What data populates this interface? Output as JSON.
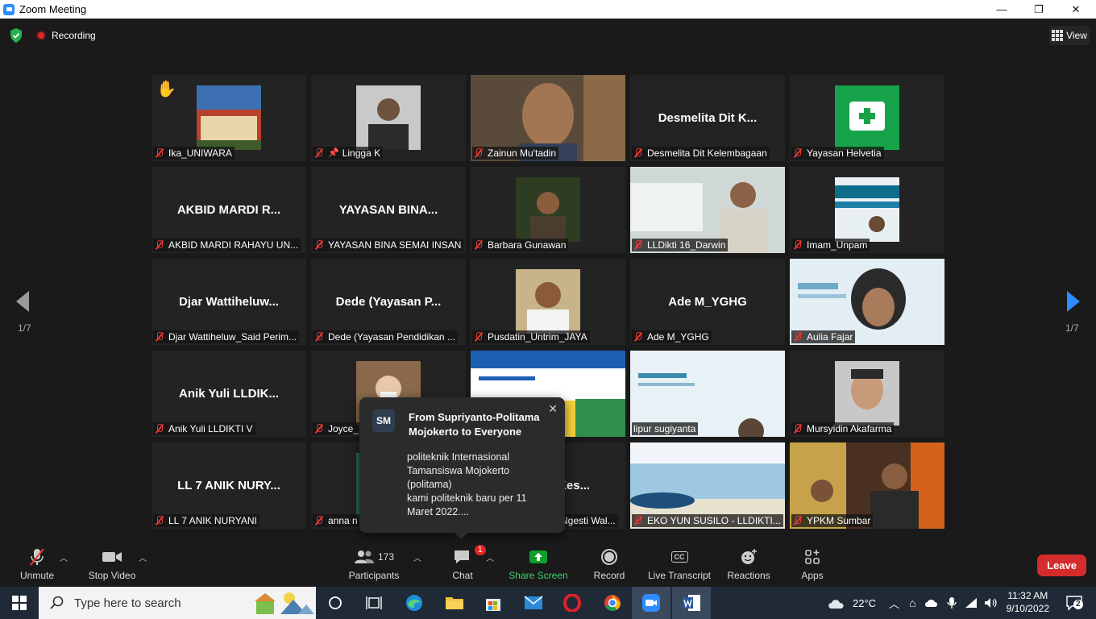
{
  "window": {
    "title": "Zoom Meeting",
    "minimize": "—",
    "maximize": "❐",
    "close": "✕"
  },
  "topbar": {
    "recording": "Recording",
    "view": "View"
  },
  "nav": {
    "page_left": "1/7",
    "page_right": "1/7"
  },
  "tiles": [
    {
      "caption": "Ika_UNIWARA",
      "kind": "photo",
      "hand": "✋"
    },
    {
      "caption": "Lingga K",
      "kind": "photo",
      "pinned": true
    },
    {
      "caption": "Zainun Mu'tadin",
      "kind": "video"
    },
    {
      "caption": "Desmelita  Dit Kelembagaan",
      "kind": "name",
      "bigname": "Desmelita  Dit K..."
    },
    {
      "caption": "Yayasan Helvetia",
      "kind": "logo"
    },
    {
      "caption": "AKBID MARDI RAHAYU UN...",
      "kind": "name",
      "bigname": "AKBID MARDI R..."
    },
    {
      "caption": "YAYASAN BINA SEMAI INSAN",
      "kind": "name",
      "bigname": "YAYASAN BINA..."
    },
    {
      "caption": "Barbara Gunawan",
      "kind": "photo"
    },
    {
      "caption": "LLDikti 16_Darwin",
      "kind": "video"
    },
    {
      "caption": "Imam_Unpam",
      "kind": "photo"
    },
    {
      "caption": "Djar Wattiheluw_Said Perim...",
      "kind": "name",
      "bigname": "Djar  Wattiheluw..."
    },
    {
      "caption": "Dede (Yayasan Pendidikan ...",
      "kind": "name",
      "bigname": "Dede (Yayasan P..."
    },
    {
      "caption": "Pusdatin_Untrim_JAYA",
      "kind": "photo"
    },
    {
      "caption": "Ade M_YGHG",
      "kind": "name",
      "bigname": "Ade M_YGHG"
    },
    {
      "caption": "Aulia Fajar",
      "kind": "video"
    },
    {
      "caption": "Anik Yuli LLDIKTI V",
      "kind": "name",
      "bigname": "Anik Yuli LLDIK..."
    },
    {
      "caption": "Joyce_",
      "kind": "photo"
    },
    {
      "caption": "",
      "kind": "video",
      "active": true
    },
    {
      "caption": "lipur sugiyanta",
      "kind": "video"
    },
    {
      "caption": "Mursyidin Akafarma",
      "kind": "photo"
    },
    {
      "caption": "LL 7 ANIK NURYANI",
      "kind": "name",
      "bigname": "LL 7 ANIK NURY..."
    },
    {
      "caption": "anna n",
      "kind": "photo"
    },
    {
      "caption": "Ngesti Wal...",
      "kind": "name",
      "bigname": "IKes..."
    },
    {
      "caption": "EKO YUN SUSILO - LLDIKTI...",
      "kind": "video"
    },
    {
      "caption": "YPKM Sumbar",
      "kind": "video"
    }
  ],
  "chat_popup": {
    "avatar": "SM",
    "from": "From Supriyanto-Politama Mojokerto to Everyone",
    "message": "politeknik Internasional Tamansiswa Mojokerto (politama)\nkami politeknik baru per 11 Maret 2022...."
  },
  "toolbar": {
    "unmute": "Unmute",
    "stop_video": "Stop Video",
    "participants": "Participants",
    "participants_count": "173",
    "chat": "Chat",
    "chat_badge": "1",
    "share_screen": "Share Screen",
    "record": "Record",
    "cc": "CC",
    "live_transcript": "Live Transcript",
    "reactions": "Reactions",
    "apps": "Apps",
    "leave": "Leave"
  },
  "taskbar": {
    "search_placeholder": "Type here to search",
    "weather": "22°C",
    "time": "11:32 AM",
    "date": "9/10/2022",
    "notifications": "2"
  },
  "colors": {
    "accent": "#2d8cff",
    "share_green": "#0e9f2c",
    "leave_red": "#d42c2c",
    "mute_red": "#e53935",
    "active_speaker": "#c8e63c"
  }
}
